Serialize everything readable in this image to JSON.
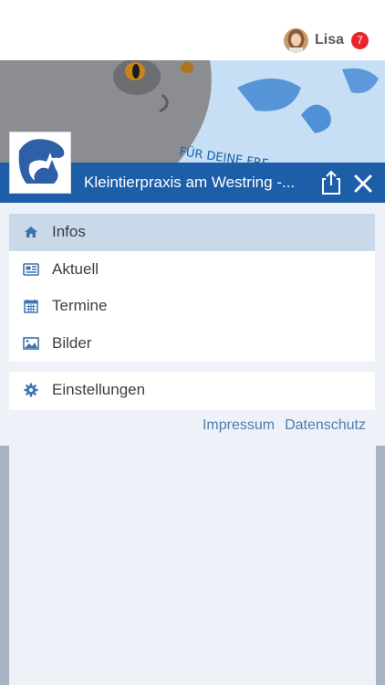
{
  "user": {
    "name": "Lisa",
    "badge": "7"
  },
  "header": {
    "title": "Kleintierpraxis am Westring -..."
  },
  "menu": {
    "items": [
      {
        "label": "Infos",
        "icon": "home-icon"
      },
      {
        "label": "Aktuell",
        "icon": "newspaper-icon"
      },
      {
        "label": "Termine",
        "icon": "calendar-icon"
      },
      {
        "label": "Bilder",
        "icon": "image-icon"
      }
    ],
    "settings": {
      "label": "Einstellungen",
      "icon": "gear-icon"
    }
  },
  "footer_links": {
    "impressum": "Impressum",
    "datenschutz": "Datenschutz"
  },
  "colors": {
    "brand": "#1d5ea8",
    "active_bg": "#c9d9ea",
    "link": "#4b7fb0",
    "badge": "#e8252b"
  }
}
